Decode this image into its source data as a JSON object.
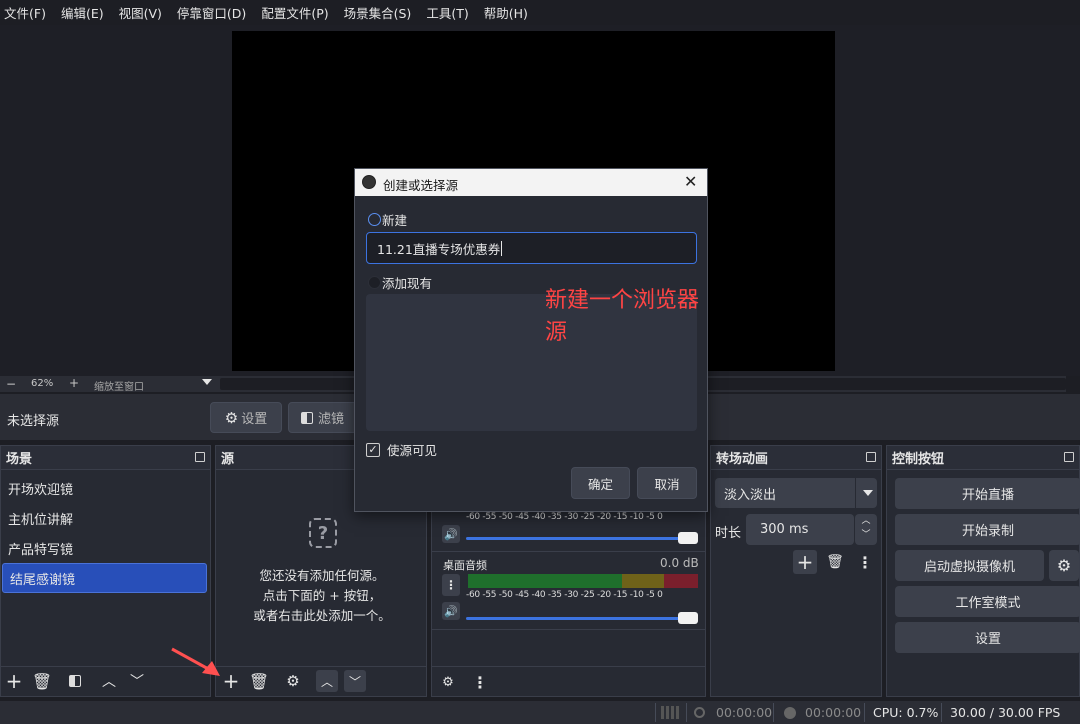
{
  "menu": [
    "文件(F)",
    "编辑(E)",
    "视图(V)",
    "停靠窗口(D)",
    "配置文件(P)",
    "场景集合(S)",
    "工具(T)",
    "帮助(H)"
  ],
  "zoom": {
    "minus": "−",
    "value": "62%",
    "plus": "+",
    "fit_label": "缩放至窗口"
  },
  "source_bar": {
    "no_source": "未选择源",
    "settings_label": "设置",
    "filters_label": "滤镜"
  },
  "scenes": {
    "title": "场景",
    "items": [
      "开场欢迎镜",
      "主机位讲解",
      "产品特写镜",
      "结尾感谢镜"
    ],
    "active_index": 3
  },
  "sources": {
    "title": "源",
    "empty_line1": "您还没有添加任何源。",
    "empty_line2": "点击下面的 + 按钮，",
    "empty_line3": "或者右击此处添加一个。"
  },
  "mixer": {
    "scale": [
      "-60",
      "-55",
      "-50",
      "-45",
      "-40",
      "-35",
      "-30",
      "-25",
      "-20",
      "-15",
      "-10",
      "-5",
      "0"
    ],
    "channel2_name": "桌面音频",
    "channel2_db": "0.0 dB"
  },
  "transitions": {
    "title": "转场动画",
    "selected": "淡入淡出",
    "duration_label": "时长",
    "duration_value": "300 ms"
  },
  "controls": {
    "title": "控制按钮",
    "start_stream": "开始直播",
    "start_record": "开始录制",
    "virtual_cam": "启动虚拟摄像机",
    "studio_mode": "工作室模式",
    "settings": "设置"
  },
  "status": {
    "stream_time": "00:00:00",
    "record_time": "00:00:00",
    "cpu": "CPU: 0.7%",
    "fps": "30.00 / 30.00 FPS"
  },
  "dialog": {
    "title": "创建或选择源",
    "new_label": "新建",
    "name_value": "11.21直播专场优惠券",
    "add_existing_label": "添加现有",
    "annotation": "新建一个浏览器源",
    "visible_label": "使源可见",
    "ok_label": "确定",
    "cancel_label": "取消"
  },
  "colors": {
    "accent": "#284fb9",
    "annotation": "#ff4444",
    "arrow": "#ff5050"
  }
}
